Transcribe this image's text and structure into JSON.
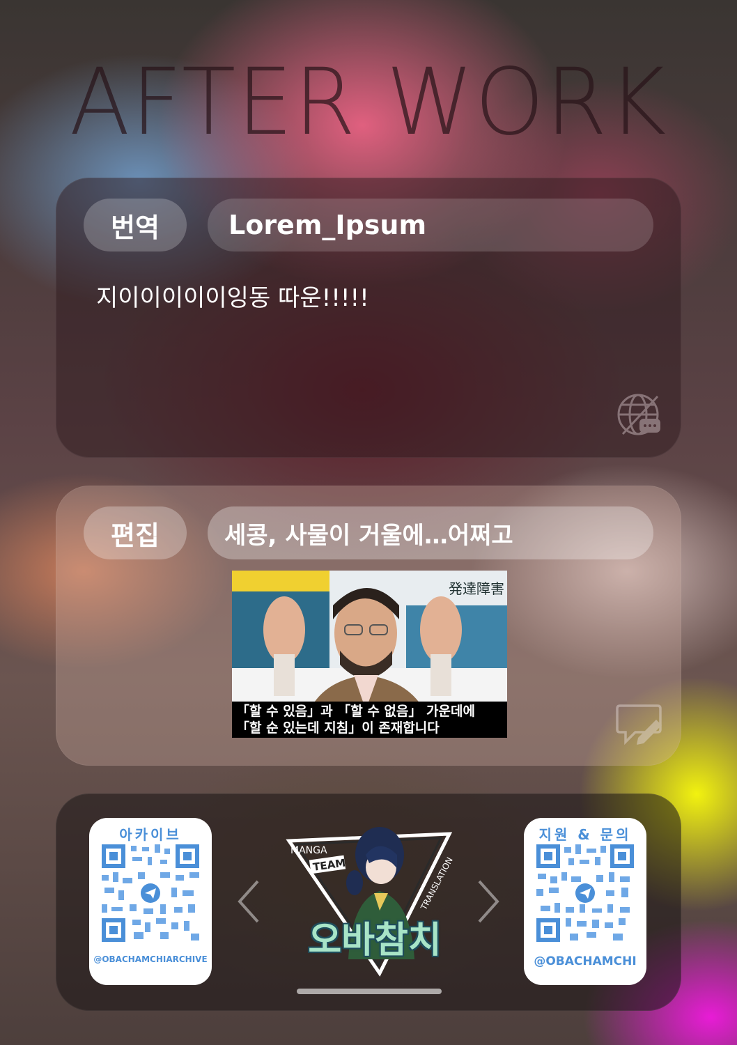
{
  "header": {
    "title": "AFTER WORK"
  },
  "translation_card": {
    "tag": "번역",
    "value": "Lorem_Ipsum",
    "text": "지이이이이이잉동 따운!!!!!",
    "icon": "globe-chat-icon"
  },
  "edit_card": {
    "tag": "편집",
    "value": "세콩, 사물이 거울에…어쩌고",
    "image": {
      "banner": "発達障害",
      "caption_line1": "「할 수 있음」과 「할 수 없음」 가운데에",
      "caption_line2": "「할 순 있는데 지침」이 존재합니다"
    },
    "icon": "edit-chat-icon"
  },
  "links_card": {
    "left_qr": {
      "title": "아카이브",
      "handle": "@OBACHAMCHIARCHIVE"
    },
    "right_qr": {
      "title": "지원 & 문의",
      "handle": "@OBACHAMCHI"
    },
    "logo": {
      "top_left": "MANGA",
      "badge": "TEAM",
      "side": "TRANSLATION",
      "name": "오바참치"
    }
  },
  "colors": {
    "qr_blue": "#4a8fd8",
    "logo_mint": "#a8e4c7"
  }
}
